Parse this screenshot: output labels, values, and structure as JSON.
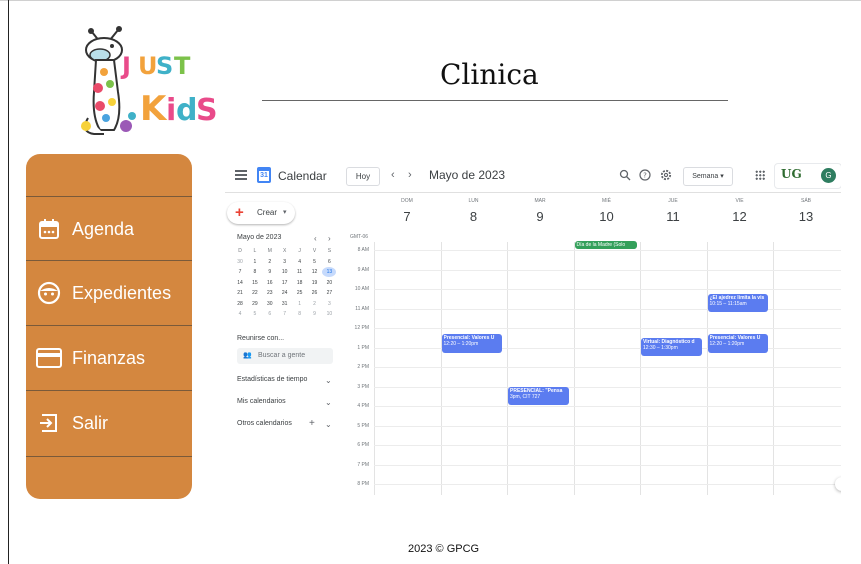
{
  "brand": {
    "logo_text": "Just Kids"
  },
  "header": {
    "title": "Clinica"
  },
  "sidebar": {
    "items": [
      {
        "label": "Agenda",
        "icon": "calendar-icon"
      },
      {
        "label": "Expedientes",
        "icon": "face-icon"
      },
      {
        "label": "Finanzas",
        "icon": "card-icon"
      },
      {
        "label": "Salir",
        "icon": "logout-icon"
      }
    ]
  },
  "calendar": {
    "app_title": "Calendar",
    "logo_day": "31",
    "today_label": "Hoy",
    "month_label": "Mayo de 2023",
    "view_label": "Semana",
    "org_logo": "UG",
    "avatar_initial": "G",
    "create_label": "Crear",
    "timezone": "GMT-06",
    "mini": {
      "title": "Mayo de 2023",
      "weekday_heads": [
        "D",
        "L",
        "M",
        "X",
        "J",
        "V",
        "S"
      ],
      "weeks": [
        [
          "30",
          "1",
          "2",
          "3",
          "4",
          "5",
          "6"
        ],
        [
          "7",
          "8",
          "9",
          "10",
          "11",
          "12",
          "13"
        ],
        [
          "14",
          "15",
          "16",
          "17",
          "18",
          "19",
          "20"
        ],
        [
          "21",
          "22",
          "23",
          "24",
          "25",
          "26",
          "27"
        ],
        [
          "28",
          "29",
          "30",
          "31",
          "1",
          "2",
          "3"
        ],
        [
          "4",
          "5",
          "6",
          "7",
          "8",
          "9",
          "10"
        ]
      ],
      "today": "13"
    },
    "meet_label": "Reunirse con...",
    "search_people_placeholder": "Buscar a gente",
    "sections": [
      "Estadísticas de tiempo",
      "Mis calendarios",
      "Otros calendarios"
    ],
    "days": [
      {
        "name": "DOM",
        "num": "7"
      },
      {
        "name": "LUN",
        "num": "8"
      },
      {
        "name": "MAR",
        "num": "9"
      },
      {
        "name": "MIÉ",
        "num": "10"
      },
      {
        "name": "JUE",
        "num": "11"
      },
      {
        "name": "VIE",
        "num": "12"
      },
      {
        "name": "SÁB",
        "num": "13"
      }
    ],
    "hours": [
      "8 AM",
      "9 AM",
      "10 AM",
      "11 AM",
      "12 PM",
      "1 PM",
      "2 PM",
      "3 PM",
      "4 PM",
      "5 PM",
      "6 PM",
      "7 PM",
      "8 PM"
    ],
    "events": [
      {
        "title": "Día de la Madre (Solo",
        "time": "",
        "day": 3,
        "allday": true,
        "color": "#33a05a"
      },
      {
        "title": "¿El ajedrez limita la vis",
        "time": "10:15 – 11:15am",
        "day": 5,
        "start": 10.25,
        "end": 11.25,
        "color": "#5b7cf0"
      },
      {
        "title": "Presencial: Valores U",
        "time": "12:20 – 1:20pm",
        "day": 1,
        "start": 12.33,
        "end": 13.33,
        "color": "#5b7cf0"
      },
      {
        "title": "Virtual: Diagnóstico d",
        "time": "12:30 – 1:30pm",
        "day": 4,
        "start": 12.5,
        "end": 13.5,
        "color": "#5b7cf0"
      },
      {
        "title": "Presencial: Valores U",
        "time": "12:20 – 1:20pm",
        "day": 5,
        "start": 12.33,
        "end": 13.33,
        "color": "#5b7cf0"
      },
      {
        "title": "PRESENCIAL: \"Pensa",
        "time": "3pm, CIT 727",
        "day": 2,
        "start": 15,
        "end": 16,
        "color": "#5b7cf0"
      }
    ]
  },
  "footer": {
    "text": "2023 © GPCG"
  }
}
